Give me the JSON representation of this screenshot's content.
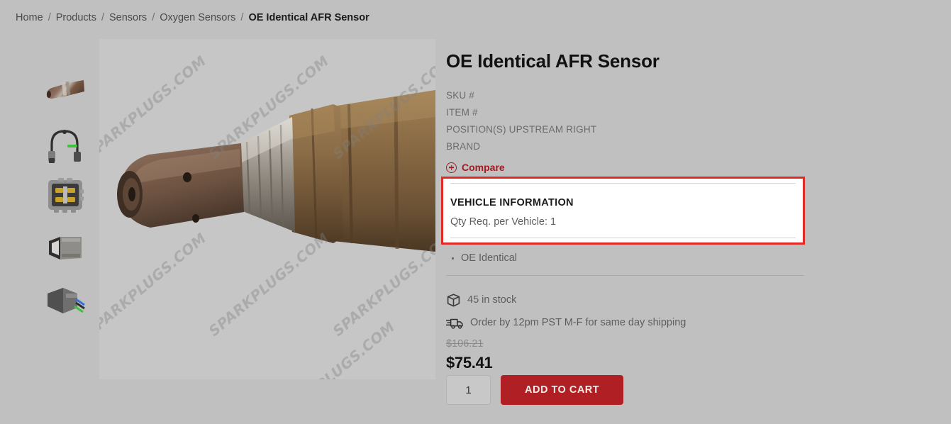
{
  "breadcrumb": {
    "items": [
      {
        "label": "Home",
        "current": false
      },
      {
        "label": "Products",
        "current": false
      },
      {
        "label": "Sensors",
        "current": false
      },
      {
        "label": "Oxygen Sensors",
        "current": false
      },
      {
        "label": "OE Identical AFR Sensor",
        "current": true
      }
    ],
    "separator": "/"
  },
  "gallery": {
    "thumbnails": [
      {
        "name": "thumbnail-sensor-body",
        "alt": "Oxygen sensor body"
      },
      {
        "name": "thumbnail-sensor-harness",
        "alt": "Sensor wiring harness"
      },
      {
        "name": "thumbnail-connector-face",
        "alt": "Connector pin face"
      },
      {
        "name": "thumbnail-connector-housing",
        "alt": "Connector housing"
      },
      {
        "name": "thumbnail-connector-wires",
        "alt": "Connector with wires"
      }
    ],
    "main_image_alt": "OE Identical AFR Sensor main product photo",
    "watermark_text": "SPARKPLUGS.COM"
  },
  "product": {
    "title": "OE Identical AFR Sensor",
    "meta": [
      {
        "label": "SKU #",
        "value": ""
      },
      {
        "label": "ITEM #",
        "value": ""
      },
      {
        "label": "POSITION(S)",
        "value": "UPSTREAM RIGHT"
      },
      {
        "label": "BRAND",
        "value": ""
      }
    ],
    "compare_label": "Compare",
    "features": [
      "OE Identical"
    ]
  },
  "vehicle_info": {
    "heading": "VEHICLE INFORMATION",
    "qty_required": "Qty Req. per Vehicle: 1"
  },
  "availability": {
    "stock_text": "45 in stock",
    "shipping_text": "Order by 12pm PST M-F for same day shipping"
  },
  "pricing": {
    "original_price": "$106.21",
    "sale_price": "$75.41"
  },
  "cart": {
    "quantity": "1",
    "add_to_cart_label": "ADD TO CART"
  },
  "colors": {
    "page_background": "#c0c0c0",
    "accent_red": "#b01f24",
    "highlight_border": "#e02b27",
    "compare_red": "#a01c22"
  }
}
